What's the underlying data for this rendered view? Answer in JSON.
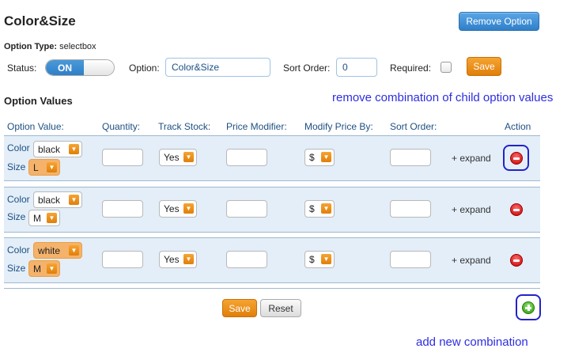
{
  "header": {
    "title": "Color&Size",
    "remove_option_label": "Remove Option"
  },
  "option_type": {
    "label": "Option Type:",
    "value": "selectbox"
  },
  "form": {
    "status_label": "Status:",
    "status_value": "ON",
    "option_label": "Option:",
    "option_value": "Color&Size",
    "sort_order_label": "Sort Order:",
    "sort_order_value": "0",
    "required_label": "Required:",
    "save_label": "Save"
  },
  "section_title": "Option Values",
  "annotations": {
    "remove_note": "remove combination of child option values",
    "add_note": "add new combination"
  },
  "columns": [
    "Option Value:",
    "Quantity:",
    "Track Stock:",
    "Price Modifier:",
    "Modify Price By:",
    "Sort Order:",
    "Action"
  ],
  "rows": [
    {
      "color_label": "Color",
      "color_value": "black",
      "size_label": "Size",
      "size_value": "L",
      "track_stock": "Yes",
      "modify_by": "$",
      "expand": "+ expand"
    },
    {
      "color_label": "Color",
      "color_value": "black",
      "size_label": "Size",
      "size_value": "M",
      "track_stock": "Yes",
      "modify_by": "$",
      "expand": "+ expand"
    },
    {
      "color_label": "Color",
      "color_value": "white",
      "size_label": "Size",
      "size_value": "M",
      "track_stock": "Yes",
      "modify_by": "$",
      "expand": "+ expand"
    }
  ],
  "footer": {
    "save_label": "Save",
    "reset_label": "Reset"
  },
  "icons": {
    "remove": "remove-circle-icon",
    "add": "add-circle-icon",
    "dropdown": "chevron-down-icon"
  },
  "colors": {
    "accent_blue": "#2f7fc9",
    "accent_orange": "#e07f0a",
    "row_bg": "#e3eef8",
    "annotation": "#2d2de0",
    "highlight_select": "#f5b26b"
  }
}
